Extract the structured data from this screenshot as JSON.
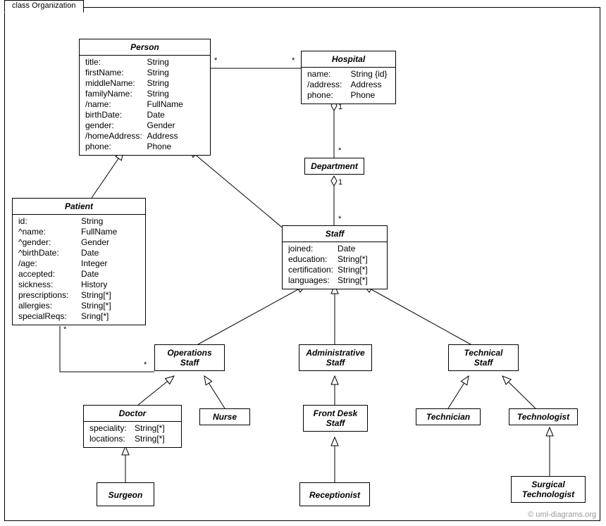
{
  "frame": {
    "title": "class Organization"
  },
  "watermark": "© uml-diagrams.org",
  "classes": {
    "person": {
      "name": "Person",
      "attr_keys": [
        "title:",
        "firstName:",
        "middleName:",
        "familyName:",
        "/name:",
        "birthDate:",
        "gender:",
        "/homeAddress:",
        "phone:"
      ],
      "attr_types": [
        "String",
        "String",
        "String",
        "String",
        "FullName",
        "Date",
        "Gender",
        "Address",
        "Phone"
      ]
    },
    "hospital": {
      "name": "Hospital",
      "attr_keys": [
        "name:",
        "/address:",
        "phone:"
      ],
      "attr_types": [
        "String {id}",
        "Address",
        "Phone"
      ]
    },
    "department": {
      "name": "Department"
    },
    "patient": {
      "name": "Patient",
      "attr_keys": [
        "id:",
        "^name:",
        "^gender:",
        "^birthDate:",
        "/age:",
        "accepted:",
        "sickness:",
        "prescriptions:",
        "allergies:",
        "specialReqs:"
      ],
      "attr_types": [
        "String",
        "FullName",
        "Gender",
        "Date",
        "Integer",
        "Date",
        "History",
        "String[*]",
        "String[*]",
        "Sring[*]"
      ]
    },
    "staff": {
      "name": "Staff",
      "attr_keys": [
        "joined:",
        "education:",
        "certification:",
        "languages:"
      ],
      "attr_types": [
        "Date",
        "String[*]",
        "String[*]",
        "String[*]"
      ]
    },
    "operations_staff": {
      "name": "Operations\nStaff"
    },
    "administrative_staff": {
      "name": "Administrative\nStaff"
    },
    "technical_staff": {
      "name": "Technical\nStaff"
    },
    "doctor": {
      "name": "Doctor",
      "attr_keys": [
        "speciality:",
        "locations:"
      ],
      "attr_types": [
        "String[*]",
        "String[*]"
      ]
    },
    "nurse": {
      "name": "Nurse"
    },
    "front_desk_staff": {
      "name": "Front Desk\nStaff"
    },
    "technician": {
      "name": "Technician"
    },
    "technologist": {
      "name": "Technologist"
    },
    "surgeon": {
      "name": "Surgeon"
    },
    "receptionist": {
      "name": "Receptionist"
    },
    "surgical_technologist": {
      "name": "Surgical\nTechnologist"
    }
  },
  "multiplicities": {
    "person_hospital_left": "*",
    "person_hospital_right": "*",
    "hospital_dept_top": "1",
    "hospital_dept_bottom": "*",
    "dept_staff_top": "1",
    "dept_staff_bottom": "*",
    "patient_ops_left": "*",
    "patient_ops_right": "*"
  }
}
